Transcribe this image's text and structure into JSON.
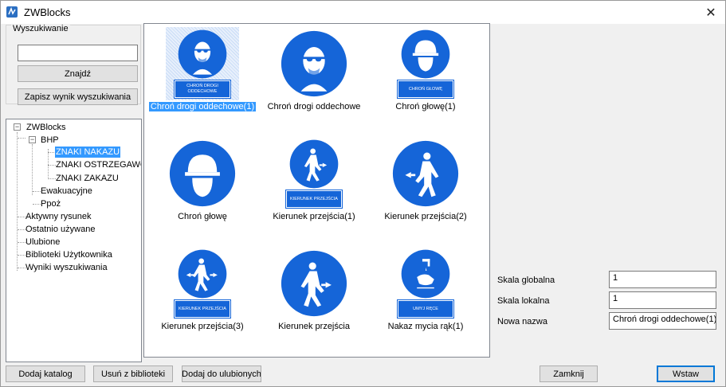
{
  "window": {
    "title": "ZWBlocks",
    "close_label": "✕"
  },
  "search": {
    "group_label": "Wyszukiwanie",
    "query": "",
    "find_label": "Znajdź",
    "save_label": "Zapisz wynik wyszukiwania"
  },
  "tree": {
    "root": "ZWBlocks",
    "bhp": "BHP",
    "znaki_nakazu": "ZNAKI NAKAZU",
    "znaki_ostrzegawcze": "ZNAKI OSTRZEGAWCZ",
    "znaki_zakazu": "ZNAKI ZAKAZU",
    "ewakuacyjne": "Ewakuacyjne",
    "ppoz": "Ppoż",
    "aktywny_rysunek": "Aktywny rysunek",
    "ostatnio_uzywane": "Ostatnio używane",
    "ulubione": "Ulubione",
    "biblioteki_uzytkownika": "Biblioteki Użytkownika",
    "wyniki_wyszukiwania": "Wyniki wyszukiwania"
  },
  "blocks": [
    {
      "caption": "Chroń drogi oddechowe(1)",
      "icon": "respirator-mask-sign-icon",
      "selected": true,
      "label_plate": "CHROŃ DROGI ODDECHOWE"
    },
    {
      "caption": "Chroń drogi oddechowe",
      "icon": "respirator-mask-sign-icon",
      "selected": false,
      "label_plate": ""
    },
    {
      "caption": "Chroń głowę(1)",
      "icon": "safety-helmet-sign-icon",
      "selected": false,
      "label_plate": "CHROŃ GŁOWĘ"
    },
    {
      "caption": "Chroń głowę",
      "icon": "safety-helmet-sign-icon",
      "selected": false,
      "label_plate": ""
    },
    {
      "caption": "Kierunek przejścia(1)",
      "icon": "walking-person-right-sign-icon",
      "selected": false,
      "label_plate": "KIERUNEK PRZEJŚCIA"
    },
    {
      "caption": "Kierunek przejścia(2)",
      "icon": "walking-person-left-sign-icon",
      "selected": false,
      "label_plate": ""
    },
    {
      "caption": "Kierunek przejścia(3)",
      "icon": "walking-person-both-ways-sign-icon",
      "selected": false,
      "label_plate": "KIERUNEK PRZEJŚCIA"
    },
    {
      "caption": "Kierunek przejścia",
      "icon": "walking-person-right-sign-icon",
      "selected": false,
      "label_plate": ""
    },
    {
      "caption": "Nakaz mycia rąk(1)",
      "icon": "hand-washing-sign-icon",
      "selected": false,
      "label_plate": "UMYJ RĘCE"
    }
  ],
  "properties": {
    "global_scale_label": "Skala globalna",
    "global_scale_value": "1",
    "local_scale_label": "Skala lokalna",
    "local_scale_value": "1",
    "new_name_label": "Nowa nazwa",
    "new_name_value": "Chroń drogi oddechowe(1)"
  },
  "buttons": {
    "add_catalog": "Dodaj katalog",
    "remove_from_library": "Usuń z biblioteki",
    "add_to_favorites": "Dodaj do ulubionych",
    "close": "Zamknij",
    "insert": "Wstaw"
  },
  "colors": {
    "sign_blue": "#1565d8",
    "selection": "#3399ff"
  }
}
